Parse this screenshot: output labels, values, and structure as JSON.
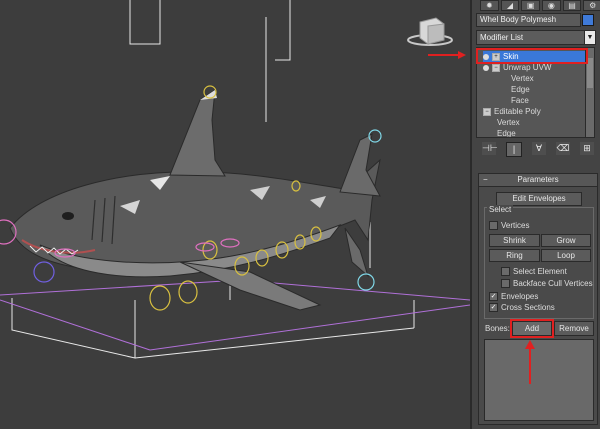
{
  "panel": {
    "tabs": [
      "✹",
      "◢",
      "▣",
      "◉",
      "▤",
      "⚙"
    ],
    "object_name": "Whel Body Polymesh",
    "object_color": "#3f7ad8",
    "modifier_list": "Modifier List",
    "dropdown_arrow": "▼",
    "stack": [
      {
        "label": "Skin",
        "selected": true
      },
      {
        "label": "Unwrap UVW",
        "selected": false
      },
      {
        "label": "Vertex",
        "selected": false
      },
      {
        "label": "Edge",
        "selected": false
      },
      {
        "label": "Face",
        "selected": false
      },
      {
        "label": "Editable Poly",
        "selected": false
      },
      {
        "label": "Vertex",
        "selected": false
      },
      {
        "label": "Edge",
        "selected": false
      }
    ],
    "tools": [
      "⊣⊢",
      "|",
      "∀",
      "⌫",
      "⊞"
    ]
  },
  "parameters": {
    "title": "Parameters",
    "collapse_symbol": "−",
    "edit_envelopes": "Edit Envelopes",
    "select_label": "Select",
    "vertices": "Vertices",
    "shrink": "Shrink",
    "grow": "Grow",
    "ring": "Ring",
    "loop": "Loop",
    "select_element": "Select Element",
    "backface_cull": "Backface Cull Vertices",
    "envelopes": "Envelopes",
    "cross_sections": "Cross Sections",
    "check_mark": "✓",
    "bones_label": "Bones:",
    "add": "Add",
    "remove": "Remove"
  },
  "colors": {
    "highlight": "#e02020",
    "selection": "#3a78d8",
    "viewport_bg": "#3d3d3d",
    "envelope_yellow": "#d8c040",
    "envelope_pink": "#e070c0",
    "envelope_cyan": "#80d8e8"
  }
}
